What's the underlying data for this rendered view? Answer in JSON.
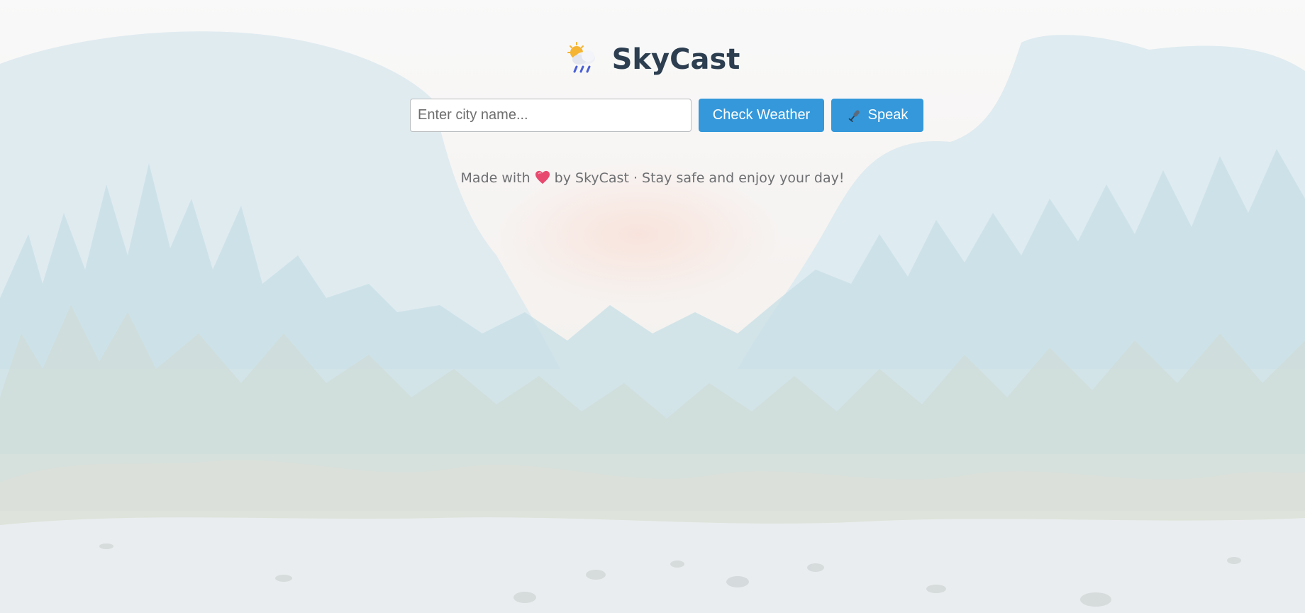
{
  "app": {
    "title": "SkyCast",
    "logo_icon": "cloud-sun-rain-icon"
  },
  "search": {
    "placeholder": "Enter city name...",
    "value": "",
    "check_label": "Check Weather",
    "speak_label": "Speak",
    "speak_icon": "microphone-icon"
  },
  "footer": {
    "before": "Made with",
    "heart_icon": "heart-icon",
    "after": "by SkyCast · Stay safe and enjoy your day!"
  },
  "colors": {
    "accent": "#3498db",
    "title": "#2c3e50",
    "footer_text": "#6d6f71",
    "heart": "#e84a6f"
  }
}
